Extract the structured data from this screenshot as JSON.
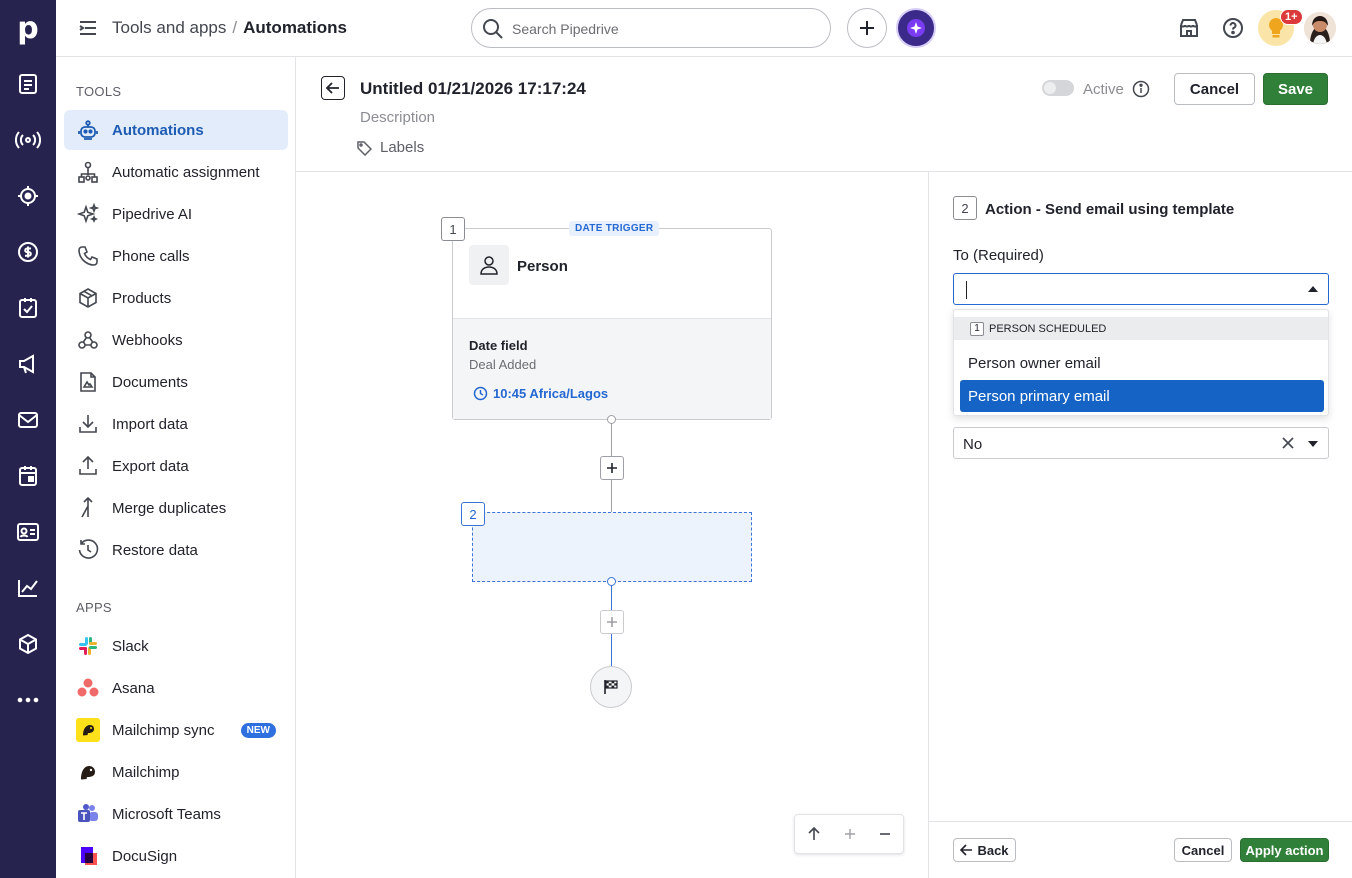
{
  "app": {
    "logo": "p"
  },
  "header": {
    "breadcrumb_parent": "Tools and apps",
    "breadcrumb_sep": "/",
    "breadcrumb_current": "Automations",
    "search_placeholder": "Search Pipedrive",
    "notif_badge": "1+"
  },
  "sidebar": {
    "tools_title": "TOOLS",
    "tools": [
      {
        "label": "Automations"
      },
      {
        "label": "Automatic assignment"
      },
      {
        "label": "Pipedrive AI"
      },
      {
        "label": "Phone calls"
      },
      {
        "label": "Products"
      },
      {
        "label": "Webhooks"
      },
      {
        "label": "Documents"
      },
      {
        "label": "Import data"
      },
      {
        "label": "Export data"
      },
      {
        "label": "Merge duplicates"
      },
      {
        "label": "Restore data"
      }
    ],
    "apps_title": "APPS",
    "apps": [
      {
        "label": "Slack"
      },
      {
        "label": "Asana"
      },
      {
        "label": "Mailchimp sync",
        "badge": "NEW"
      },
      {
        "label": "Mailchimp"
      },
      {
        "label": "Microsoft Teams"
      },
      {
        "label": "DocuSign"
      }
    ]
  },
  "automation": {
    "title": "Untitled 01/21/2026 17:17:24",
    "description_placeholder": "Description",
    "labels": "Labels",
    "active_label": "Active",
    "cancel": "Cancel",
    "save": "Save"
  },
  "canvas": {
    "node1": {
      "number": "1",
      "tag": "DATE TRIGGER",
      "entity": "Person",
      "field_title": "Date field",
      "field_value": "Deal Added",
      "time": "10:45 Africa/Lagos"
    },
    "node2": {
      "number": "2"
    }
  },
  "panel": {
    "step_number": "2",
    "title": "Action - Send email using template",
    "to_label": "To (Required)",
    "dropdown": {
      "group_number": "1",
      "group_label": "PERSON SCHEDULED",
      "options": [
        {
          "label": "Person owner email",
          "selected": false
        },
        {
          "label": "Person primary email",
          "selected": true
        }
      ]
    },
    "second_select_value": "No",
    "back": "Back",
    "cancel": "Cancel",
    "apply": "Apply action"
  },
  "colors": {
    "rail": "#26244e",
    "accent_blue": "#1563c4",
    "save_green": "#31803a",
    "active_nav_bg": "#e2ecfb"
  }
}
